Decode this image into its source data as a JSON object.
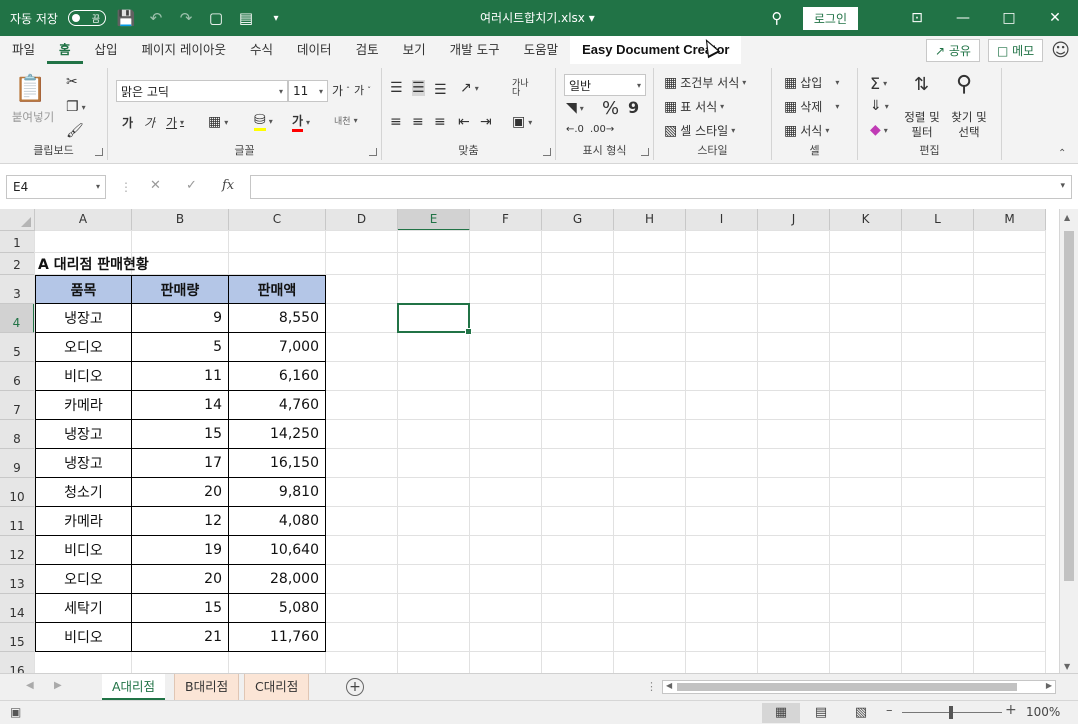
{
  "titlebar": {
    "autosave_label": "자동 저장",
    "autosave_state": "끔",
    "doc_title": "여러시트합치기.xlsx",
    "login_label": "로그인"
  },
  "tabs": {
    "items": [
      "파일",
      "홈",
      "삽입",
      "페이지 레이아웃",
      "수식",
      "데이터",
      "검토",
      "보기",
      "개발 도구",
      "도움말"
    ],
    "plugin": "Easy Document Creator",
    "share_label": "공유",
    "memo_label": "메모"
  },
  "ribbon": {
    "clipboard": {
      "paste_label": "붙여넣기",
      "group_label": "클립보드"
    },
    "font": {
      "font_name": "맑은 고딕",
      "font_size": "11",
      "grow": "가",
      "shrink": "가",
      "bold": "가",
      "italic": "가",
      "underline": "가",
      "font_color_char": "가",
      "phonetic": "내천",
      "group_label": "글꼴"
    },
    "align": {
      "wrap": "가나\n다",
      "group_label": "맞춤"
    },
    "number": {
      "format": "일반",
      "percent": "%",
      "comma": "9",
      "group_label": "표시 형식"
    },
    "styles": {
      "conditional": "조건부 서식",
      "table": "표 서식",
      "cell": "셀 스타일",
      "group_label": "스타일"
    },
    "cells": {
      "insert": "삽입",
      "delete": "삭제",
      "format": "서식",
      "group_label": "셀"
    },
    "editing": {
      "sort": "정렬 및\n필터",
      "find": "찾기 및\n선택",
      "group_label": "편집"
    }
  },
  "formula_bar": {
    "name_box": "E4",
    "fx": "fx",
    "value": ""
  },
  "grid": {
    "columns": [
      "A",
      "B",
      "C",
      "D",
      "E",
      "F",
      "G",
      "H",
      "I",
      "J",
      "K",
      "L",
      "M"
    ],
    "rows": [
      "1",
      "2",
      "3",
      "4",
      "5",
      "6",
      "7",
      "8",
      "9",
      "10",
      "11",
      "12",
      "13",
      "14",
      "15",
      "16"
    ],
    "selected_cell": "E4",
    "title": "A 대리점 판매현황",
    "headers": [
      "품목",
      "판매량",
      "판매액"
    ],
    "data": [
      [
        "냉장고",
        "9",
        "8,550"
      ],
      [
        "오디오",
        "5",
        "7,000"
      ],
      [
        "비디오",
        "11",
        "6,160"
      ],
      [
        "카메라",
        "14",
        "4,760"
      ],
      [
        "냉장고",
        "15",
        "14,250"
      ],
      [
        "냉장고",
        "17",
        "16,150"
      ],
      [
        "청소기",
        "20",
        "9,810"
      ],
      [
        "카메라",
        "12",
        "4,080"
      ],
      [
        "비디오",
        "19",
        "10,640"
      ],
      [
        "오디오",
        "20",
        "28,000"
      ],
      [
        "세탁기",
        "15",
        "5,080"
      ],
      [
        "비디오",
        "21",
        "11,760"
      ]
    ]
  },
  "sheets": {
    "tabs": [
      "A대리점",
      "B대리점",
      "C대리점"
    ],
    "active": "A대리점"
  },
  "status": {
    "zoom": "100%"
  }
}
